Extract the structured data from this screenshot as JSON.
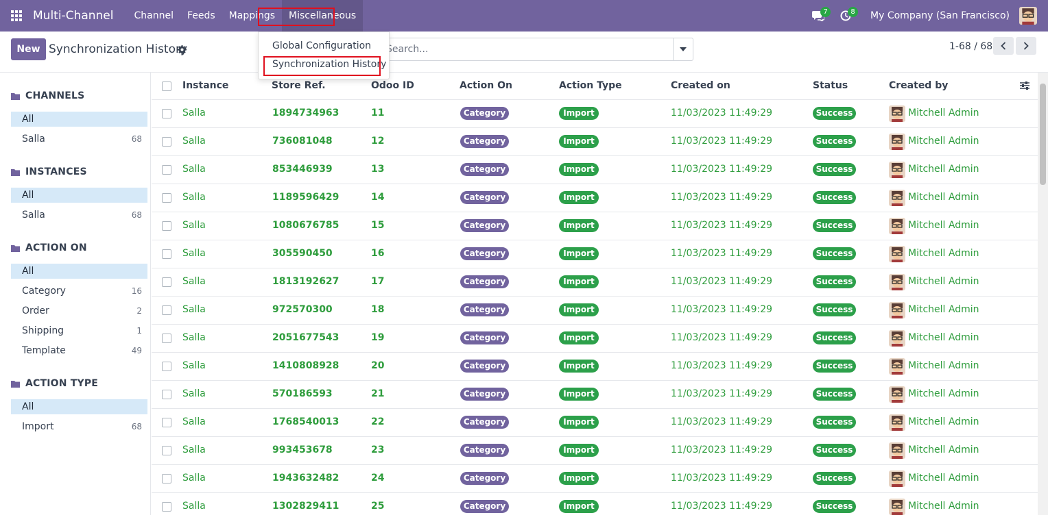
{
  "app": {
    "name": "Multi-Channel"
  },
  "nav": [
    {
      "label": "Channel"
    },
    {
      "label": "Feeds"
    },
    {
      "label": "Mappings"
    },
    {
      "label": "Miscellaneous"
    }
  ],
  "systray": {
    "messages_count": "7",
    "activities_count": "8",
    "company": "My Company (San Francisco)"
  },
  "control": {
    "new_label": "New",
    "title": "Synchronization History",
    "search_placeholder": "Search...",
    "pager": "1-68 / 68"
  },
  "dropdown": {
    "items": [
      {
        "label": "Global Configuration"
      },
      {
        "label": "Synchronization History"
      }
    ]
  },
  "sidebar": {
    "sections": [
      {
        "title": "CHANNELS",
        "items": [
          {
            "label": "All",
            "count": ""
          },
          {
            "label": "Salla",
            "count": "68"
          }
        ]
      },
      {
        "title": "INSTANCES",
        "items": [
          {
            "label": "All",
            "count": ""
          },
          {
            "label": "Salla",
            "count": "68"
          }
        ]
      },
      {
        "title": "ACTION ON",
        "items": [
          {
            "label": "All",
            "count": ""
          },
          {
            "label": "Category",
            "count": "16"
          },
          {
            "label": "Order",
            "count": "2"
          },
          {
            "label": "Shipping",
            "count": "1"
          },
          {
            "label": "Template",
            "count": "49"
          }
        ]
      },
      {
        "title": "ACTION TYPE",
        "items": [
          {
            "label": "All",
            "count": ""
          },
          {
            "label": "Import",
            "count": "68"
          }
        ]
      }
    ]
  },
  "table": {
    "columns": [
      "Instance",
      "Store Ref.",
      "Odoo ID",
      "Action On",
      "Action Type",
      "Created on",
      "Status",
      "Created by"
    ],
    "rows": [
      {
        "instance": "Salla",
        "store_ref": "1894734963",
        "odoo_id": "11",
        "action_on": "Category",
        "action_type": "Import",
        "created_on": "11/03/2023 11:49:29",
        "status": "Success",
        "created_by": "Mitchell Admin"
      },
      {
        "instance": "Salla",
        "store_ref": "736081048",
        "odoo_id": "12",
        "action_on": "Category",
        "action_type": "Import",
        "created_on": "11/03/2023 11:49:29",
        "status": "Success",
        "created_by": "Mitchell Admin"
      },
      {
        "instance": "Salla",
        "store_ref": "853446939",
        "odoo_id": "13",
        "action_on": "Category",
        "action_type": "Import",
        "created_on": "11/03/2023 11:49:29",
        "status": "Success",
        "created_by": "Mitchell Admin"
      },
      {
        "instance": "Salla",
        "store_ref": "1189596429",
        "odoo_id": "14",
        "action_on": "Category",
        "action_type": "Import",
        "created_on": "11/03/2023 11:49:29",
        "status": "Success",
        "created_by": "Mitchell Admin"
      },
      {
        "instance": "Salla",
        "store_ref": "1080676785",
        "odoo_id": "15",
        "action_on": "Category",
        "action_type": "Import",
        "created_on": "11/03/2023 11:49:29",
        "status": "Success",
        "created_by": "Mitchell Admin"
      },
      {
        "instance": "Salla",
        "store_ref": "305590450",
        "odoo_id": "16",
        "action_on": "Category",
        "action_type": "Import",
        "created_on": "11/03/2023 11:49:29",
        "status": "Success",
        "created_by": "Mitchell Admin"
      },
      {
        "instance": "Salla",
        "store_ref": "1813192627",
        "odoo_id": "17",
        "action_on": "Category",
        "action_type": "Import",
        "created_on": "11/03/2023 11:49:29",
        "status": "Success",
        "created_by": "Mitchell Admin"
      },
      {
        "instance": "Salla",
        "store_ref": "972570300",
        "odoo_id": "18",
        "action_on": "Category",
        "action_type": "Import",
        "created_on": "11/03/2023 11:49:29",
        "status": "Success",
        "created_by": "Mitchell Admin"
      },
      {
        "instance": "Salla",
        "store_ref": "2051677543",
        "odoo_id": "19",
        "action_on": "Category",
        "action_type": "Import",
        "created_on": "11/03/2023 11:49:29",
        "status": "Success",
        "created_by": "Mitchell Admin"
      },
      {
        "instance": "Salla",
        "store_ref": "1410808928",
        "odoo_id": "20",
        "action_on": "Category",
        "action_type": "Import",
        "created_on": "11/03/2023 11:49:29",
        "status": "Success",
        "created_by": "Mitchell Admin"
      },
      {
        "instance": "Salla",
        "store_ref": "570186593",
        "odoo_id": "21",
        "action_on": "Category",
        "action_type": "Import",
        "created_on": "11/03/2023 11:49:29",
        "status": "Success",
        "created_by": "Mitchell Admin"
      },
      {
        "instance": "Salla",
        "store_ref": "1768540013",
        "odoo_id": "22",
        "action_on": "Category",
        "action_type": "Import",
        "created_on": "11/03/2023 11:49:29",
        "status": "Success",
        "created_by": "Mitchell Admin"
      },
      {
        "instance": "Salla",
        "store_ref": "993453678",
        "odoo_id": "23",
        "action_on": "Category",
        "action_type": "Import",
        "created_on": "11/03/2023 11:49:29",
        "status": "Success",
        "created_by": "Mitchell Admin"
      },
      {
        "instance": "Salla",
        "store_ref": "1943632482",
        "odoo_id": "24",
        "action_on": "Category",
        "action_type": "Import",
        "created_on": "11/03/2023 11:49:29",
        "status": "Success",
        "created_by": "Mitchell Admin"
      },
      {
        "instance": "Salla",
        "store_ref": "1302829411",
        "odoo_id": "25",
        "action_on": "Category",
        "action_type": "Import",
        "created_on": "11/03/2023 11:49:29",
        "status": "Success",
        "created_by": "Mitchell Admin"
      }
    ]
  },
  "colors": {
    "brand": "#71639e",
    "success": "#2ca04a",
    "link_green": "#2f9d3d",
    "highlight": "#e0101e"
  }
}
